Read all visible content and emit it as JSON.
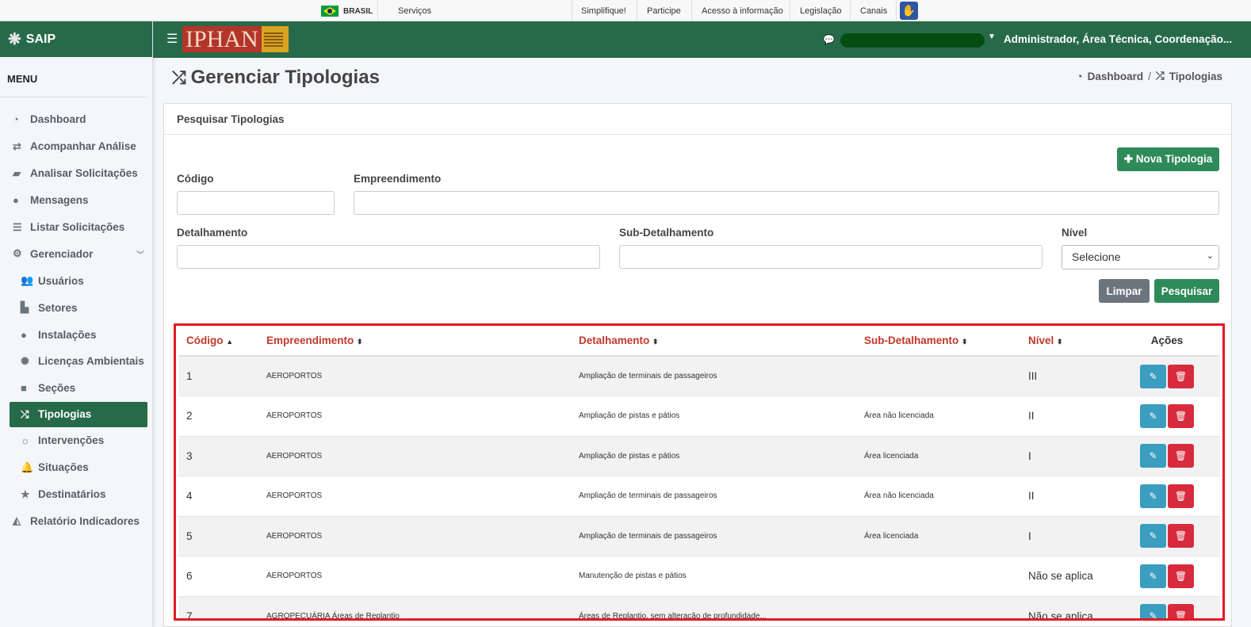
{
  "govbar": {
    "brasil": "BRASIL",
    "servicos": "Serviços",
    "links": [
      "Simplifique!",
      "Participe",
      "Acesso à informação",
      "Legislação",
      "Canais"
    ]
  },
  "sidebar": {
    "app_name": "SAIP",
    "menu_title": "MENU",
    "items": [
      {
        "label": "Dashboard",
        "icon": "dashboard-icon"
      },
      {
        "label": "Acompanhar Análise",
        "icon": "exchange-icon"
      },
      {
        "label": "Analisar Solicitações",
        "icon": "book-icon"
      },
      {
        "label": "Mensagens",
        "icon": "comments-icon"
      },
      {
        "label": "Listar Solicitações",
        "icon": "list-icon"
      },
      {
        "label": "Gerenciador",
        "icon": "cogs-icon"
      },
      {
        "label": "Usuários",
        "icon": "users-icon"
      },
      {
        "label": "Setores",
        "icon": "industry-icon"
      },
      {
        "label": "Instalações",
        "icon": "circle-icon"
      },
      {
        "label": "Licenças Ambientais",
        "icon": "certificate-icon"
      },
      {
        "label": "Seções",
        "icon": "square-icon"
      },
      {
        "label": "Tipologias",
        "icon": "random-icon"
      },
      {
        "label": "Intervenções",
        "icon": "sun-icon"
      },
      {
        "label": "Situações",
        "icon": "bell-icon"
      },
      {
        "label": "Destinatários",
        "icon": "star-icon"
      },
      {
        "label": "Relatório Indicadores",
        "icon": "area-chart-icon"
      }
    ]
  },
  "header": {
    "logo_text": "IPHAN",
    "user_label": "Administrador, Área Técnica, Coordenação..."
  },
  "page": {
    "title": "Gerenciar Tipologias",
    "breadcrumb": [
      "Dashboard",
      "/",
      "Tipologias"
    ]
  },
  "search": {
    "card_title": "Pesquisar Tipologias",
    "new_button": "Nova Tipologia",
    "codigo_label": "Código",
    "empreendimento_label": "Empreendimento",
    "detalhamento_label": "Detalhamento",
    "subdetalhamento_label": "Sub-Detalhamento",
    "nivel_label": "Nível",
    "nivel_value": "Selecione",
    "clear_button": "Limpar",
    "search_button": "Pesquisar"
  },
  "table": {
    "headers": [
      "Código",
      "Empreendimento",
      "Detalhamento",
      "Sub-Detalhamento",
      "Nível",
      "Ações"
    ],
    "rows": [
      {
        "codigo": "1",
        "empreendimento": "AEROPORTOS",
        "detalhamento": "Ampliação de terminais de passageiros",
        "sub": "",
        "nivel": "III"
      },
      {
        "codigo": "2",
        "empreendimento": "AEROPORTOS",
        "detalhamento": "Ampliação de pistas e pátios",
        "sub": "Área não licenciada",
        "nivel": "II"
      },
      {
        "codigo": "3",
        "empreendimento": "AEROPORTOS",
        "detalhamento": "Ampliação de pistas e pátios",
        "sub": "Área licenciada",
        "nivel": "I"
      },
      {
        "codigo": "4",
        "empreendimento": "AEROPORTOS",
        "detalhamento": "Ampliação de terminais de passageiros",
        "sub": "Área não licenciada",
        "nivel": "II"
      },
      {
        "codigo": "5",
        "empreendimento": "AEROPORTOS",
        "detalhamento": "Ampliação de terminais de passageiros",
        "sub": "Área licenciada",
        "nivel": "I"
      },
      {
        "codigo": "6",
        "empreendimento": "AEROPORTOS",
        "detalhamento": "Manutenção de pistas e pátios",
        "sub": "",
        "nivel": "Não se aplica"
      },
      {
        "codigo": "7",
        "empreendimento": "AGROPECUÁRIA Áreas de Replantio",
        "detalhamento": "Áreas de Replantio, sem alteração de profundidade...",
        "sub": "",
        "nivel": "Não se aplica"
      }
    ]
  },
  "colors": {
    "primary_green": "#276a4a",
    "button_green": "#2f8a5a",
    "highlight_red": "#e31b23",
    "edit_blue": "#3b9dbf",
    "delete_red": "#d72b3d"
  }
}
